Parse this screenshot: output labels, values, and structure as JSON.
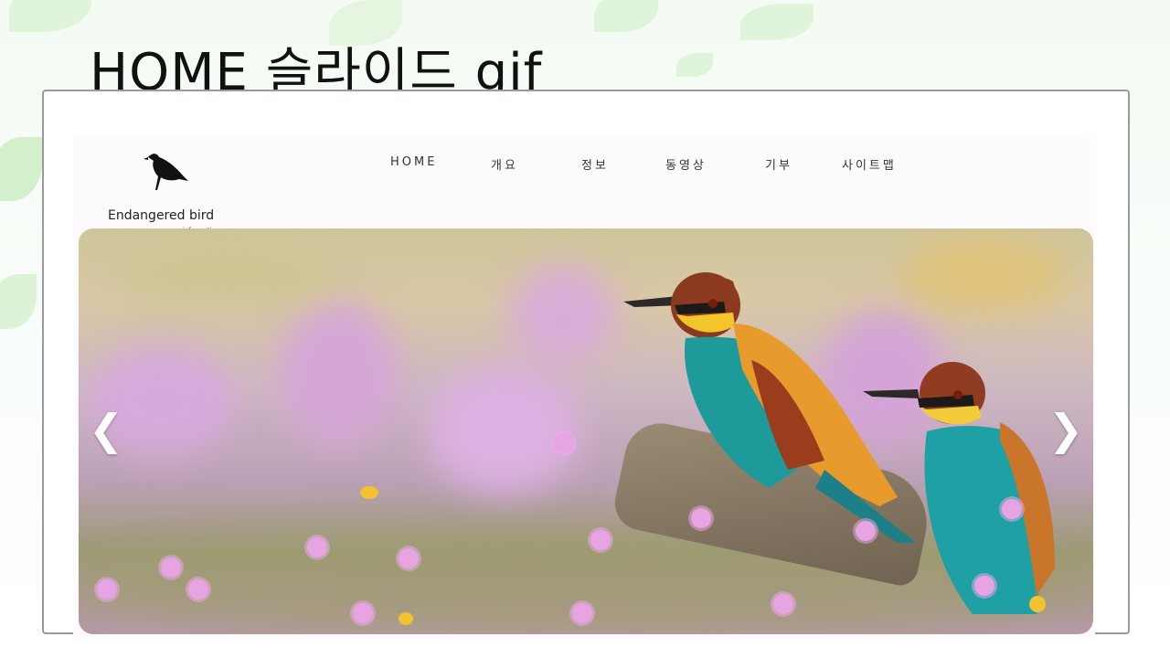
{
  "slide": {
    "title": "HOME 슬라이드 gif"
  },
  "site": {
    "logo": {
      "name": "Endangered bird",
      "subtitle": "information"
    },
    "nav": [
      {
        "label": "HOME"
      },
      {
        "label": "개요"
      },
      {
        "label": "정보"
      },
      {
        "label": "동영상"
      },
      {
        "label": "기부"
      },
      {
        "label": "사이트맵"
      }
    ]
  },
  "slider": {
    "prev": "❮",
    "next": "❯",
    "image_subject": "two bee-eater birds perched on a log among pink wildflowers"
  },
  "colors": {
    "background": "#f3fbf3",
    "leaf": "#b8e6a8",
    "frame_border": "#9a9a9a",
    "site_bg": "#fdfbfd"
  }
}
